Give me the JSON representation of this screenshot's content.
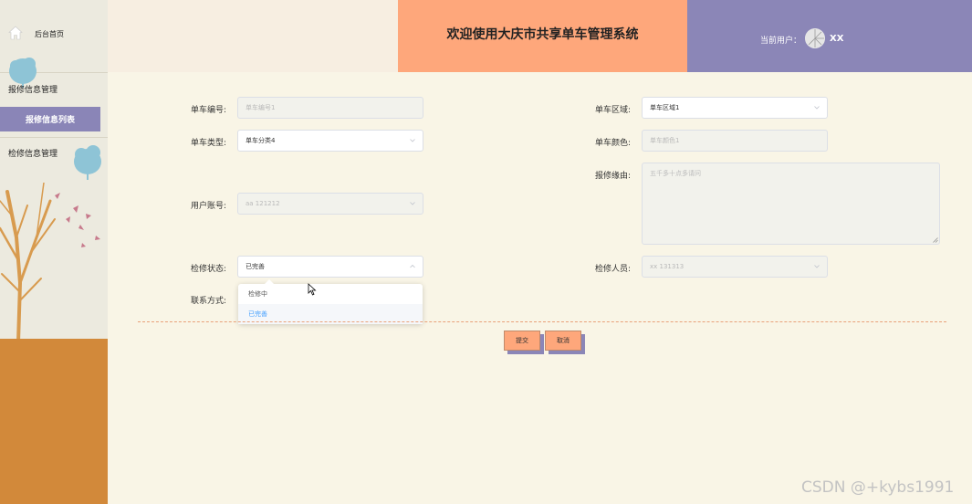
{
  "sidebar": {
    "home_label": "后台首页",
    "menu": [
      {
        "label": "报修信息管理"
      },
      {
        "label": "检修信息管理"
      }
    ],
    "active_item": "报修信息列表"
  },
  "header": {
    "title": "欢迎使用大庆市共享单车管理系统",
    "user_label": "当前用户：",
    "user_name": "XX"
  },
  "form": {
    "bike_no": {
      "label": "单车编号:",
      "value": "单车编号1"
    },
    "bike_area": {
      "label": "单车区域:",
      "value": "单车区域1"
    },
    "bike_type": {
      "label": "单车类型:",
      "value": "单车分类4"
    },
    "bike_color": {
      "label": "单车颜色:",
      "value": "单车颜色1"
    },
    "reason": {
      "label": "报修缘由:",
      "value": "五千多十点多请问"
    },
    "user_account": {
      "label": "用户账号:",
      "value": "aa 121212"
    },
    "repair_status": {
      "label": "检修状态:",
      "value": "已完善"
    },
    "repairer": {
      "label": "检修人员:",
      "value": "xx 131313"
    },
    "contact": {
      "label": "联系方式:"
    },
    "status_options": [
      "检修中",
      "已完善"
    ]
  },
  "buttons": {
    "submit": "提交",
    "cancel": "取消"
  },
  "watermark": "CSDN @+kybs1991",
  "colors": {
    "accent_orange": "#fea77b",
    "accent_purple": "#8b86b7",
    "ground": "#d2893a",
    "background": "#f9f5e6",
    "selected_option": "#409eff"
  }
}
